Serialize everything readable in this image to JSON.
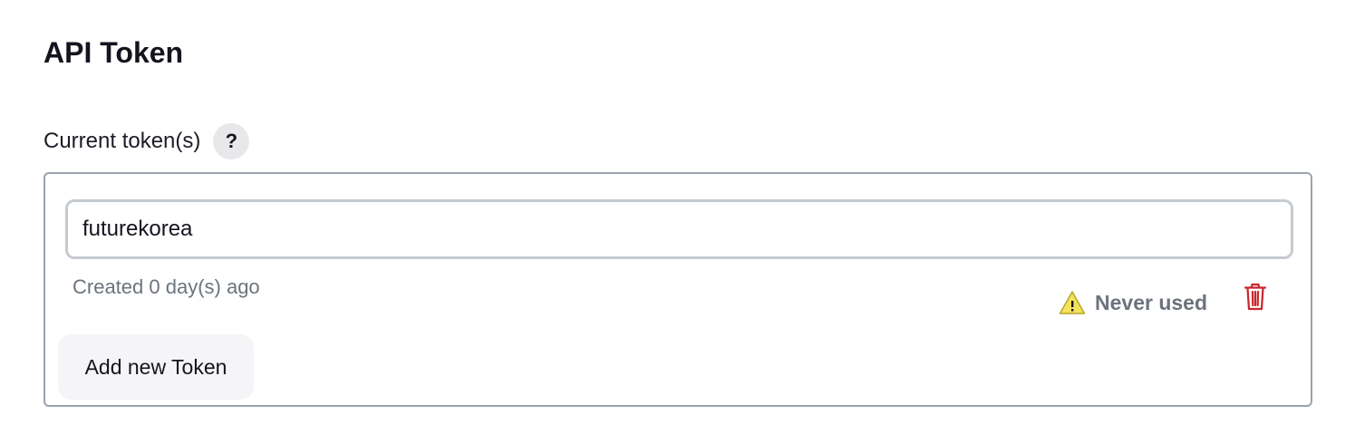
{
  "page": {
    "title": "API Token"
  },
  "tokens_section": {
    "label": "Current token(s)",
    "help_label": "?",
    "token": {
      "name": "futurekorea",
      "created": "Created 0 day(s) ago",
      "usage": "Never used"
    },
    "add_button_label": "Add new Token"
  },
  "icons": {
    "help": "question-icon",
    "usage_warning": "warning-icon",
    "delete": "trash-icon"
  },
  "colors": {
    "warning_fill": "#f3e35c",
    "delete_icon": "#c9252c",
    "muted_text": "#6c737c"
  }
}
